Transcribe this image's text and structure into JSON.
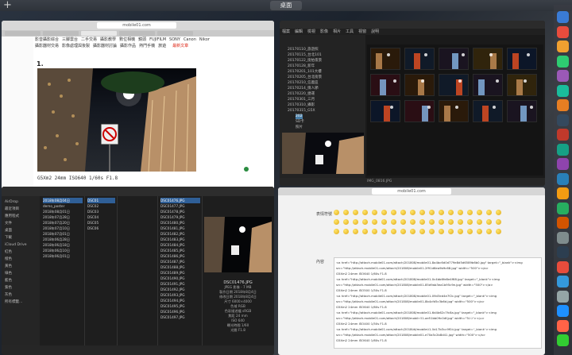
{
  "mission_control": {
    "desktop_label": "桌面"
  },
  "browser": {
    "url": "mobile01.com",
    "nav_items": [
      "影音攝影綜合",
      "三腳雲台",
      "二手交易",
      "攝影教學",
      "數位相機",
      "鏡頭",
      "FUJIFILM",
      "SONY",
      "Canon",
      "Nikon"
    ],
    "nav_row2": [
      "攝影器材交易",
      "影像處理與後製",
      "攝影器材討論",
      "攝影作品",
      "熱門手機",
      "旅遊"
    ],
    "hot_label": "最新文章",
    "post_number": "1.",
    "caption": "G5Xm2 24mm ISO640 1/60s F1.8"
  },
  "catalog": {
    "menu": [
      "檔案",
      "編輯",
      "檢視",
      "影像",
      "相片",
      "工具",
      "視窗",
      "說明"
    ],
    "tree_items": [
      "20170110_旅遊照",
      "20170115_台北101",
      "20170122_街拍夜景",
      "20170128_新年",
      "20170201_101大樓",
      "20170205_台北街景",
      "20170210_信義區",
      "20170214_情人節",
      "20170220_捷運",
      "20170301_三月",
      "20170310_攝影",
      "20170315_G5X",
      "202",
      "SD卡",
      "照片"
    ],
    "selected_tree_item": "202",
    "status": "IMG_0816.JPG"
  },
  "finder": {
    "sidebar_sections": [
      "AirDrop",
      "最近項目",
      "應用程式",
      "文件",
      "桌面",
      "下載",
      "iCloud Drive",
      "紅色",
      "橙色",
      "黃色",
      "綠色",
      "藍色",
      "紫色",
      "灰色",
      "所有標籤…"
    ],
    "col1": [
      "2018年08月04日",
      "demo_poster",
      "2018年08月01日",
      "2018年07月28日",
      "2018年07月20日",
      "2018年07月10日",
      "2018年07月01日",
      "2018年06月28日",
      "2018年06月18日",
      "2018年06月10日",
      "2018年06月01日"
    ],
    "col2": [
      "DSC01",
      "DSC02",
      "DSC03",
      "DSC04",
      "DSC05",
      "DSC06"
    ],
    "col3": [
      "DSC01476.JPG",
      "DSC01477.JPG",
      "DSC01478.JPG",
      "DSC01479.JPG",
      "DSC01480.JPG",
      "DSC01481.JPG",
      "DSC01482.JPG",
      "DSC01483.JPG",
      "DSC01484.JPG",
      "DSC01485.JPG",
      "DSC01486.JPG",
      "DSC01487.JPG",
      "DSC01488.JPG",
      "DSC01489.JPG",
      "DSC01490.JPG",
      "DSC01491.JPG",
      "DSC01492.JPG",
      "DSC01493.JPG",
      "DSC01494.JPG",
      "DSC01495.JPG",
      "DSC01496.JPG",
      "DSC01497.JPG"
    ],
    "selected_file": "DSC01476.JPG",
    "preview_name": "DSC01476.JPG",
    "preview_meta": [
      "JPEG 影像 - 7 MB",
      "製作日期 2018年8月4日",
      "修改日期 2018年8月4日",
      "尺寸 6000×4000",
      "色域 RGB",
      "色彩描述檔 sRGB",
      "焦距 24 mm",
      "ISO 640",
      "曝光時間 1/60",
      "光圈 F1.8"
    ]
  },
  "editor": {
    "url": "mobile01.com",
    "label_smilies": "表情符號",
    "label_content": "內容",
    "lines": [
      "<a href=\"http://attach.mobile01.com/attach/201808/mobile01-8a4bc6d0d779e8d5d6589b6b0.jpg\" target=\"_blank\"><img",
      "src=\"http://attach.mobile01.com/attach/201808/mobile01-2f91d6ea9b9c68.jpg\" width=\"500\"></a>",
      "G5Xm2 24mm ISO640 1/60s F1.8",
      "<a href=\"http://attach.mobile01.com/attach/201808/mobile01-0c4bb6fe8e4f68.jpg\" target=\"_blank\"><img",
      "src=\"http://attach.mobile01.com/attach/201808/mobile01-85d9ab3ea1b95c9e.jpg\" width=\"500\"></a>",
      "G5Xm2 24mm ISO500 1/50s F1.8",
      "<a href=\"http://attach.mobile01.com/attach/201808/mobile01-09d3ed4e7f2c.jpg\" target=\"_blank\"><img",
      "src=\"http://attach.mobile01.com/attach/201808/mobile01-8b4cfd5c3b6d.jpg\" width=\"500\"></a>",
      "G5Xm2 24mm ISO640 1/60s F1.8",
      "<a href=\"http://attach.mobile01.com/attach/201808/mobile01-6d4b62c7fc8a.jpg\" target=\"_blank\"><img",
      "src=\"http://attach.mobile01.com/attach/201808/mobile01-ae51bb09c0df.jpg\" width=\"500\"></a>",
      "G5Xm2 24mm ISO400 1/50s F1.8",
      "<a href=\"http://attach.mobile01.com/attach/201808/mobile01-5d17b3cc9f04.jpg\" target=\"_blank\"><img",
      "src=\"http://attach.mobile01.com/attach/201808/mobile01-e70a5c2b8d41.jpg\" width=\"500\"></a>",
      "G5Xm2 24mm ISO640 1/60s F1.8"
    ]
  },
  "watermark": "Aaron Liu",
  "colors": {
    "accent": "#2f5f97",
    "catalog_select": "#4a7fa8",
    "hot": "#dd2211"
  }
}
